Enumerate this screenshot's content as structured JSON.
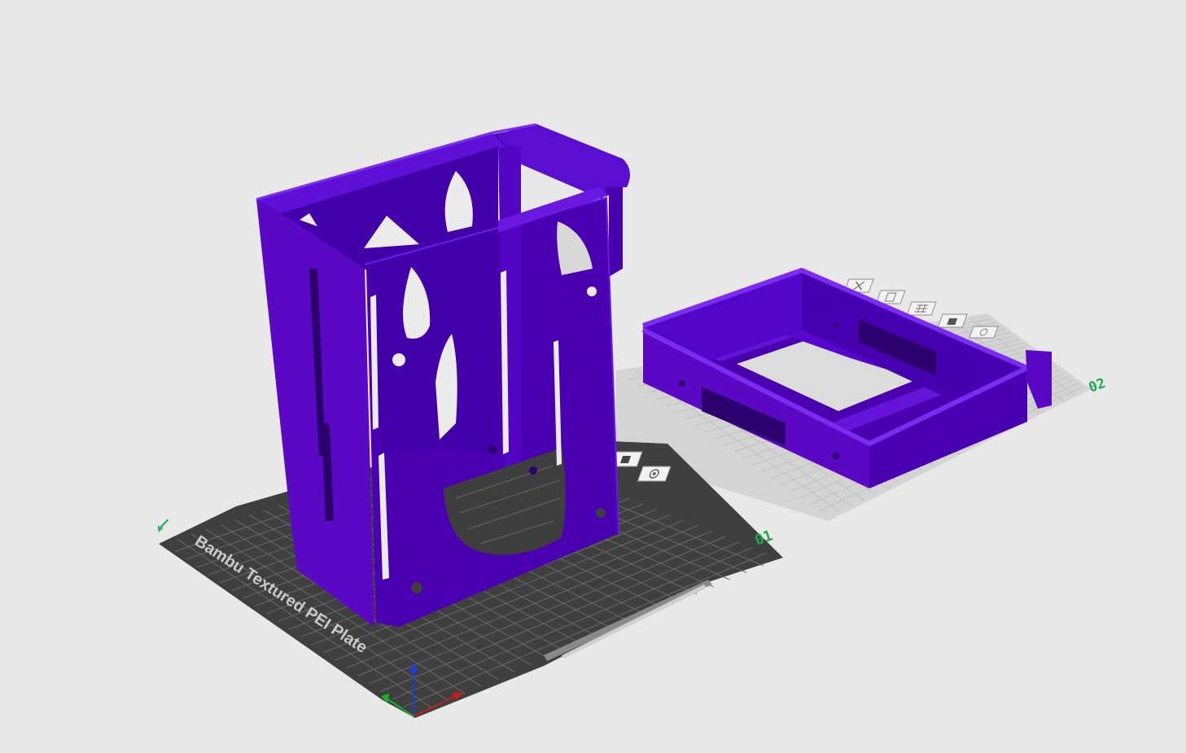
{
  "plates": [
    {
      "index_label": "01",
      "brand_text": "Bambu Textured PEI Plate",
      "active": true
    },
    {
      "index_label": "02",
      "active": false
    }
  ],
  "plate_toolbar_icons": [
    "close-icon",
    "copy-icon",
    "grid-icon",
    "lock-icon",
    "settings-icon"
  ],
  "plate_one_icons": [
    "lock-icon",
    "settings-icon"
  ],
  "colors": {
    "background": "#e8e8e8",
    "model_main": "#5a08c4",
    "model_dark": "#3f0093",
    "model_light": "#7a2cf0",
    "plate_dark": "#3f3f3f",
    "plate_grid": "#6a6a6a",
    "plate_inactive": "#d4d4d4",
    "plate_label": "#1fa84f",
    "axis_x": "#c41f1f",
    "axis_y": "#1fae2b",
    "axis_z": "#1f3bd6"
  }
}
